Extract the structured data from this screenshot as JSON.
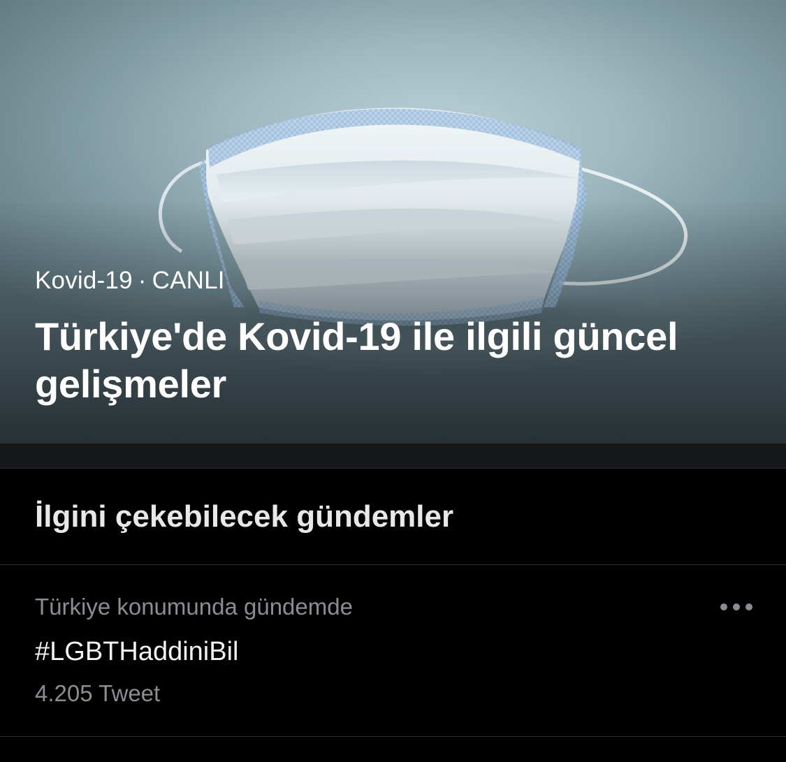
{
  "hero": {
    "topic": "Kovid-19",
    "separator": "·",
    "status": "CANLI",
    "title": "Türkiye'de Kovid-19 ile ilgili güncel gelişmeler",
    "image_icon": "face-mask-photo"
  },
  "section": {
    "title": "İlgini çekebilecek gündemler"
  },
  "trends": [
    {
      "context": "Türkiye konumunda gündemde",
      "name": "#LGBTHaddiniBil",
      "count": "4.205 Tweet",
      "more_icon": "more-horizontal-icon"
    }
  ],
  "colors": {
    "background": "#000000",
    "text_primary": "#f2f2f4",
    "text_secondary": "#8b8d92",
    "divider": "#2a2c2f"
  }
}
